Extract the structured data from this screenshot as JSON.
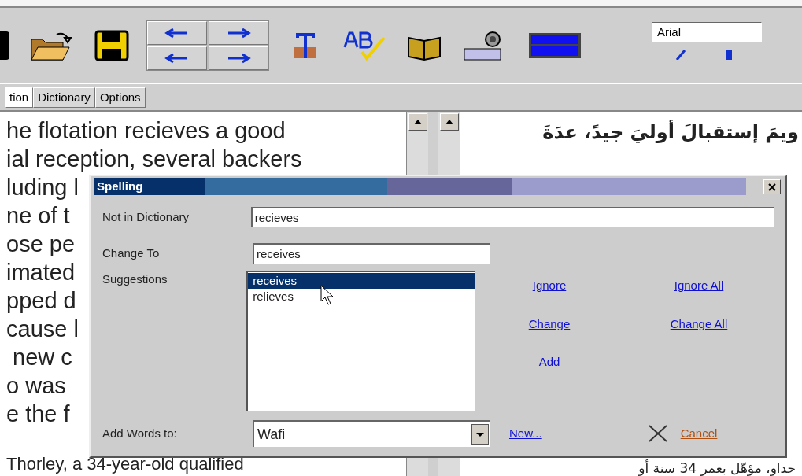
{
  "toolbar": {
    "font_field": {
      "value": "Arial"
    }
  },
  "tabs": [
    {
      "label": "tion",
      "selected": true
    },
    {
      "label": "Dictionary",
      "selected": false
    },
    {
      "label": "Options",
      "selected": false
    }
  ],
  "english_pane": {
    "lines": [
      "he flotation recieves a good",
      "ial reception, several backers",
      "luding l",
      "ne of t",
      "ose pe",
      "imated",
      "pped d",
      "cause l",
      " new c",
      "o was",
      "e the f"
    ],
    "bottom_line": "Thorley, a 34-year-old qualified"
  },
  "arabic_pane": {
    "lines": [
      "ويمَ إستقبالَ أوليَ جيدً، عدَةَ"
    ],
    "bottom_line": "حداو، مؤهّل بعمر 34 سنة أو"
  },
  "dialog": {
    "title": "Spelling",
    "not_in_dictionary": {
      "label": "Not in Dictionary",
      "value": "recieves"
    },
    "change_to": {
      "label": "Change To",
      "value": "receives"
    },
    "suggestions": {
      "label": "Suggestions",
      "items": [
        {
          "text": "receives",
          "selected": true
        },
        {
          "text": "relieves",
          "selected": false
        }
      ]
    },
    "actions": [
      [
        "Ignore",
        "Ignore All"
      ],
      [
        "Change",
        "Change All"
      ],
      [
        "Add"
      ]
    ],
    "add_words_to": {
      "label": "Add Words to:",
      "value": "Wafi"
    },
    "new_link": "New...",
    "cancel": "Cancel"
  }
}
